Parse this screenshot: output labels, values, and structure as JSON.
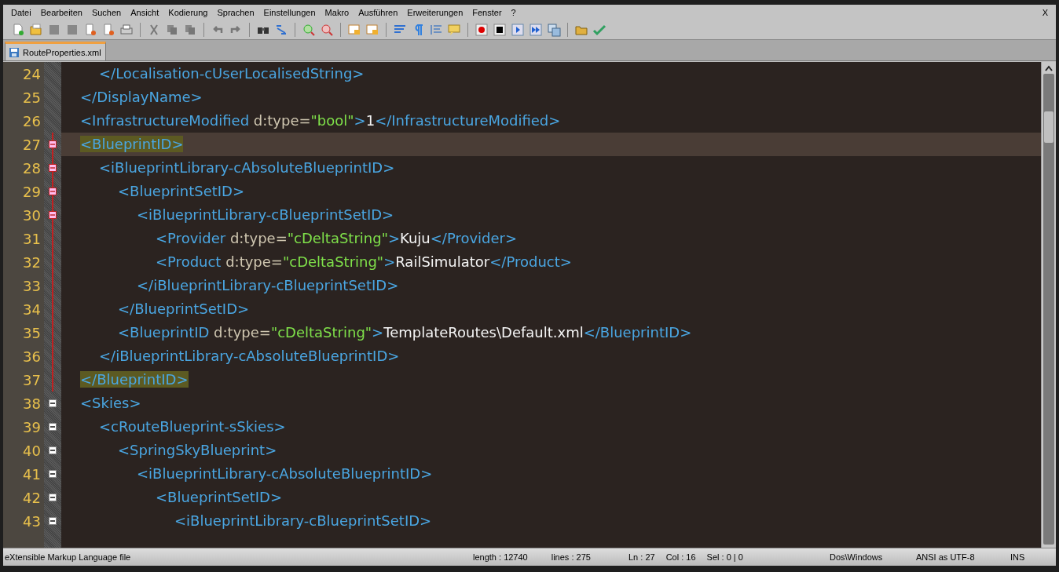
{
  "menu": [
    "Datei",
    "Bearbeiten",
    "Suchen",
    "Ansicht",
    "Kodierung",
    "Sprachen",
    "Einstellungen",
    "Makro",
    "Ausführen",
    "Erweiterungen",
    "Fenster",
    "?"
  ],
  "close_label": "X",
  "tabs": [
    {
      "label": "RouteProperties.xml",
      "selected": true
    }
  ],
  "editor": {
    "lines": [
      {
        "number": "24",
        "kind": "close",
        "collapsible": false,
        "in_block": false,
        "current": false,
        "segments": [
          {
            "kind": "tag",
            "text": "</Localisation-cUserLocalisedString>",
            "matched": false
          }
        ]
      },
      {
        "number": "25",
        "kind": "close",
        "collapsible": false,
        "in_block": false,
        "current": false,
        "segments": [
          {
            "kind": "tag",
            "text": "</DisplayName>",
            "matched": false
          }
        ]
      },
      {
        "number": "26",
        "kind": "leaf",
        "collapsible": false,
        "in_block": false,
        "current": false,
        "segments": [
          {
            "kind": "tag",
            "text": "<InfrastructureModified",
            "matched": false
          },
          {
            "kind": "attr",
            "text": " d:type=",
            "matched": false
          },
          {
            "kind": "value",
            "text": "\"bool\"",
            "matched": false
          },
          {
            "kind": "tag",
            "text": ">",
            "matched": false
          },
          {
            "kind": "text",
            "text": "1",
            "matched": false
          },
          {
            "kind": "tag",
            "text": "</InfrastructureModified>",
            "matched": false
          }
        ]
      },
      {
        "number": "27",
        "kind": "open",
        "collapsible": true,
        "in_block": true,
        "current": true,
        "segments": [
          {
            "kind": "tag",
            "text": "<BlueprintID>",
            "matched": true
          }
        ]
      },
      {
        "number": "28",
        "kind": "open",
        "collapsible": true,
        "in_block": true,
        "current": false,
        "segments": [
          {
            "kind": "tag",
            "text": "<iBlueprintLibrary-cAbsoluteBlueprintID>",
            "matched": false
          }
        ]
      },
      {
        "number": "29",
        "kind": "open",
        "collapsible": true,
        "in_block": true,
        "current": false,
        "segments": [
          {
            "kind": "tag",
            "text": "<BlueprintSetID>",
            "matched": false
          }
        ]
      },
      {
        "number": "30",
        "kind": "open",
        "collapsible": true,
        "in_block": true,
        "current": false,
        "segments": [
          {
            "kind": "tag",
            "text": "<iBlueprintLibrary-cBlueprintSetID>",
            "matched": false
          }
        ]
      },
      {
        "number": "31",
        "kind": "leaf",
        "collapsible": false,
        "in_block": true,
        "current": false,
        "segments": [
          {
            "kind": "tag",
            "text": "<Provider",
            "matched": false
          },
          {
            "kind": "attr",
            "text": " d:type=",
            "matched": false
          },
          {
            "kind": "value",
            "text": "\"cDeltaString\"",
            "matched": false
          },
          {
            "kind": "tag",
            "text": ">",
            "matched": false
          },
          {
            "kind": "text",
            "text": "Kuju",
            "matched": false
          },
          {
            "kind": "tag",
            "text": "</Provider>",
            "matched": false
          }
        ]
      },
      {
        "number": "32",
        "kind": "leaf",
        "collapsible": false,
        "in_block": true,
        "current": false,
        "segments": [
          {
            "kind": "tag",
            "text": "<Product",
            "matched": false
          },
          {
            "kind": "attr",
            "text": " d:type=",
            "matched": false
          },
          {
            "kind": "value",
            "text": "\"cDeltaString\"",
            "matched": false
          },
          {
            "kind": "tag",
            "text": ">",
            "matched": false
          },
          {
            "kind": "text",
            "text": "RailSimulator",
            "matched": false
          },
          {
            "kind": "tag",
            "text": "</Product>",
            "matched": false
          }
        ]
      },
      {
        "number": "33",
        "kind": "close",
        "collapsible": false,
        "in_block": true,
        "current": false,
        "segments": [
          {
            "kind": "tag",
            "text": "</iBlueprintLibrary-cBlueprintSetID>",
            "matched": false
          }
        ]
      },
      {
        "number": "34",
        "kind": "close",
        "collapsible": false,
        "in_block": true,
        "current": false,
        "segments": [
          {
            "kind": "tag",
            "text": "</BlueprintSetID>",
            "matched": false
          }
        ]
      },
      {
        "number": "35",
        "kind": "leaf",
        "collapsible": false,
        "in_block": true,
        "current": false,
        "segments": [
          {
            "kind": "tag",
            "text": "<BlueprintID",
            "matched": false
          },
          {
            "kind": "attr",
            "text": " d:type=",
            "matched": false
          },
          {
            "kind": "value",
            "text": "\"cDeltaString\"",
            "matched": false
          },
          {
            "kind": "tag",
            "text": ">",
            "matched": false
          },
          {
            "kind": "text",
            "text": "TemplateRoutes\\Default.xml",
            "matched": false
          },
          {
            "kind": "tag",
            "text": "</BlueprintID>",
            "matched": false
          }
        ]
      },
      {
        "number": "36",
        "kind": "close",
        "collapsible": false,
        "in_block": true,
        "current": false,
        "segments": [
          {
            "kind": "tag",
            "text": "</iBlueprintLibrary-cAbsoluteBlueprintID>",
            "matched": false
          }
        ]
      },
      {
        "number": "37",
        "kind": "close",
        "collapsible": false,
        "in_block": true,
        "current": false,
        "segments": [
          {
            "kind": "tag",
            "text": "</BlueprintID>",
            "matched": true
          }
        ]
      },
      {
        "number": "38",
        "kind": "open",
        "collapsible": true,
        "in_block": false,
        "current": false,
        "segments": [
          {
            "kind": "tag",
            "text": "<Skies>",
            "matched": false
          }
        ]
      },
      {
        "number": "39",
        "kind": "open",
        "collapsible": true,
        "in_block": false,
        "current": false,
        "segments": [
          {
            "kind": "tag",
            "text": "<cRouteBlueprint-sSkies>",
            "matched": false
          }
        ]
      },
      {
        "number": "40",
        "kind": "open",
        "collapsible": true,
        "in_block": false,
        "current": false,
        "segments": [
          {
            "kind": "tag",
            "text": "<SpringSkyBlueprint>",
            "matched": false
          }
        ]
      },
      {
        "number": "41",
        "kind": "open",
        "collapsible": true,
        "in_block": false,
        "current": false,
        "segments": [
          {
            "kind": "tag",
            "text": "<iBlueprintLibrary-cAbsoluteBlueprintID>",
            "matched": false
          }
        ]
      },
      {
        "number": "42",
        "kind": "open",
        "collapsible": true,
        "in_block": false,
        "current": false,
        "segments": [
          {
            "kind": "tag",
            "text": "<BlueprintSetID>",
            "matched": false
          }
        ]
      },
      {
        "number": "43",
        "kind": "open",
        "collapsible": true,
        "in_block": false,
        "current": false,
        "segments": [
          {
            "kind": "tag",
            "text": "<iBlueprintLibrary-cBlueprintSetID>",
            "matched": false
          }
        ]
      }
    ]
  },
  "status_bar": {
    "file_type": "eXtensible Markup Language file",
    "length": "length : 12740",
    "lines": "lines : 275",
    "ln": "Ln : 27",
    "col": "Col : 16",
    "sel": "Sel : 0 | 0",
    "eol": "Dos\\Windows",
    "encoding": "ANSI as UTF-8",
    "mode": "INS"
  }
}
